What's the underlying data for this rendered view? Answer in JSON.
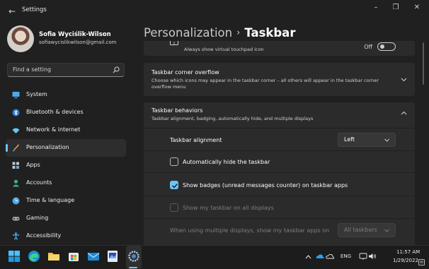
{
  "window": {
    "app_title": "Settings",
    "back_glyph": "←",
    "controls": {
      "minimize": "–",
      "maximize": "❐",
      "close": "✕"
    }
  },
  "profile": {
    "name": "Sofia Wyciślik-Wilson",
    "email": "sofiawycislikwilson@gmail.com"
  },
  "search": {
    "placeholder": "Find a setting",
    "icon": "search-icon"
  },
  "nav": {
    "items": [
      {
        "label": "System",
        "icon": "monitor-icon",
        "color": "#4fa8e8"
      },
      {
        "label": "Bluetooth & devices",
        "icon": "bluetooth-icon",
        "color": "#4fa8e8"
      },
      {
        "label": "Network & internet",
        "icon": "wifi-icon",
        "color": "#6cc4f5"
      },
      {
        "label": "Personalization",
        "icon": "brush-icon",
        "color": "#e8a25a",
        "active": true
      },
      {
        "label": "Apps",
        "icon": "apps-icon",
        "color": "#b8c8d8"
      },
      {
        "label": "Accounts",
        "icon": "person-icon",
        "color": "#3fb37f"
      },
      {
        "label": "Time & language",
        "icon": "globe-clock-icon",
        "color": "#4fa8e8"
      },
      {
        "label": "Gaming",
        "icon": "controller-icon",
        "color": "#a0a0a0"
      },
      {
        "label": "Accessibility",
        "icon": "accessibility-icon",
        "color": "#4fa8e8"
      }
    ]
  },
  "header": {
    "parent": "Personalization",
    "separator": "›",
    "current": "Taskbar"
  },
  "touchpad_row": {
    "text": "Always show virtual touchpad icon",
    "toggle_label": "Off",
    "toggle_on": false
  },
  "corner_overflow": {
    "title": "Taskbar corner overflow",
    "description_line1": "Choose which icons may appear in the taskbar corner – all others will appear in the taskbar corner",
    "description_line2": "overflow menu"
  },
  "behaviors": {
    "title": "Taskbar behaviors",
    "description": "Taskbar alignment, badging, automatically hide, and multiple displays",
    "alignment": {
      "label": "Taskbar alignment",
      "value": "Left"
    },
    "auto_hide": {
      "label": "Automatically hide the taskbar",
      "checked": false
    },
    "badges": {
      "label": "Show badges (unread messages counter) on taskbar apps",
      "checked": true
    },
    "all_displays": {
      "label": "Show my taskbar on all displays",
      "checked": false,
      "disabled": true
    },
    "multi_display": {
      "label": "When using multiple displays, show my taskbar apps on",
      "value": "All taskbars",
      "disabled": true
    }
  },
  "taskbar": {
    "language": "ENG",
    "time": "11:57 AM",
    "date": "1/29/2022",
    "apps": [
      "windows-start-icon",
      "edge-icon",
      "file-explorer-icon",
      "store-icon",
      "mail-icon",
      "image-editor-icon",
      "settings-icon"
    ]
  },
  "colors": {
    "accent": "#6cc4f5",
    "background": "#202020",
    "card": "#2b2b2b"
  }
}
